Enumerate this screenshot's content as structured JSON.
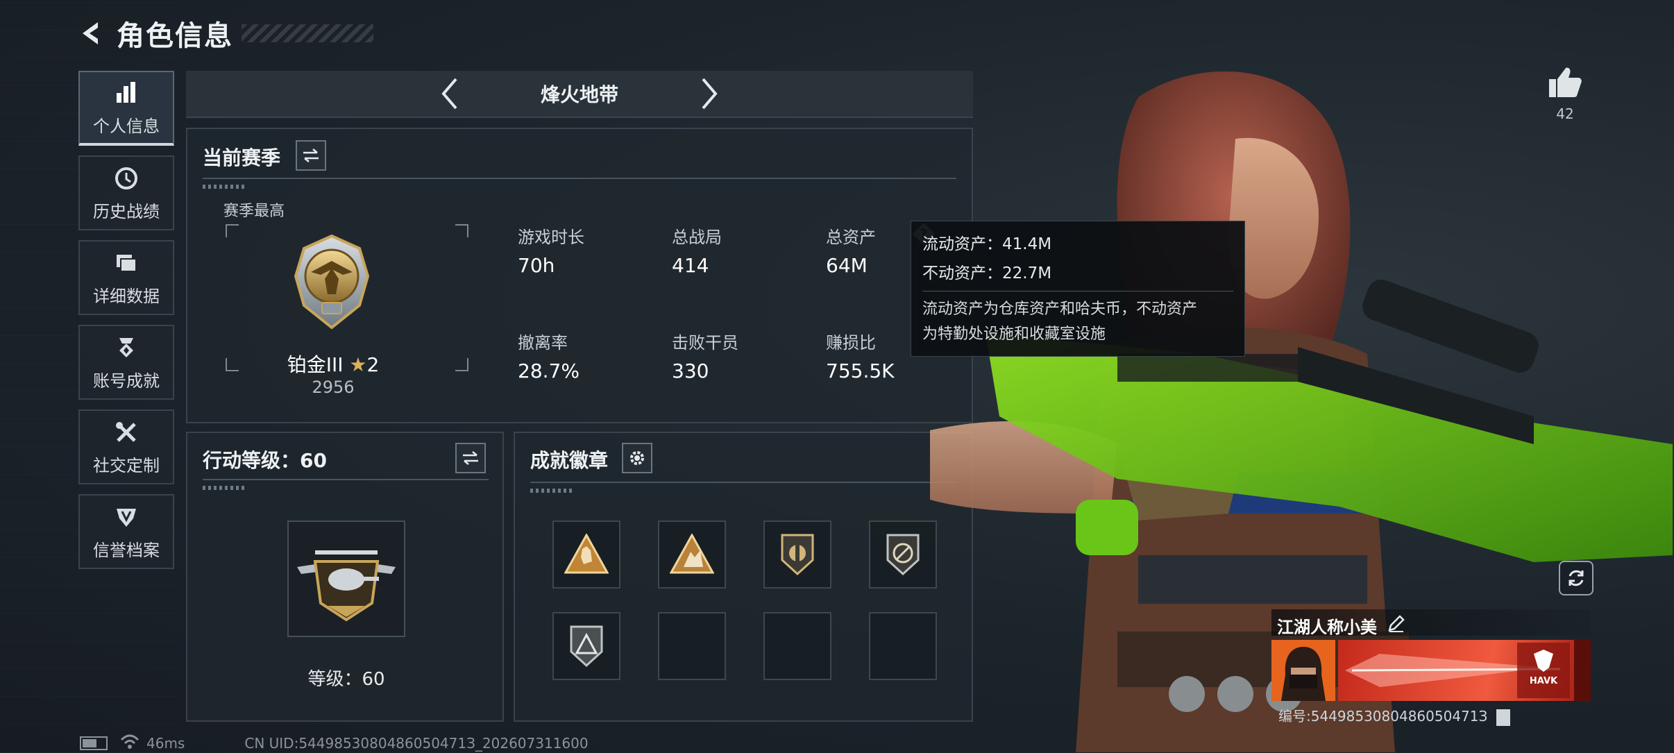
{
  "header": {
    "title": "角色信息"
  },
  "sidenav": {
    "items": [
      {
        "label": "个人信息",
        "icon": "bar-chart-icon"
      },
      {
        "label": "历史战绩",
        "icon": "clock-history-icon"
      },
      {
        "label": "详细数据",
        "icon": "folders-icon"
      },
      {
        "label": "账号成就",
        "icon": "medal-icon"
      },
      {
        "label": "社交定制",
        "icon": "tools-icon"
      },
      {
        "label": "信誉档案",
        "icon": "shield-badge-icon"
      }
    ]
  },
  "mode_bar": {
    "title": "烽火地带"
  },
  "season": {
    "title": "当前赛季",
    "best_label": "赛季最高",
    "rank_name": "铂金III",
    "rank_stars": "2",
    "rank_score": "2956",
    "stats": [
      {
        "label": "游戏时长",
        "value": "70h"
      },
      {
        "label": "总战局",
        "value": "414"
      },
      {
        "label": "总资产",
        "value": "64M"
      },
      {
        "label": "撤离率",
        "value": "28.7%"
      },
      {
        "label": "击败干员",
        "value": "330"
      },
      {
        "label": "赚损比",
        "value": "755.5K"
      }
    ]
  },
  "tooltip": {
    "liquid": "流动资产：41.4M",
    "fixed": "不动资产：22.7M",
    "desc_line1": "流动资产为仓库资产和哈夫币，不动资产",
    "desc_line2": "为特勤处设施和收藏室设施"
  },
  "action_level": {
    "title": "行动等级：60",
    "level_text": "等级：60"
  },
  "badges": {
    "title": "成就徽章",
    "slots": [
      "hand-triangle-badge",
      "climber-triangle-badge",
      "shield-emblem-badge",
      "compass-shield-badge",
      "triangle-shield-badge",
      "",
      "",
      ""
    ]
  },
  "player": {
    "name": "江湖人称小美",
    "id_text": "编号:5449853080486050471З",
    "likes": "42",
    "card_logo_text": "HAVK"
  },
  "status": {
    "ping": "46ms",
    "uid": "CN UID:5449853080486050471З_202607311600"
  }
}
